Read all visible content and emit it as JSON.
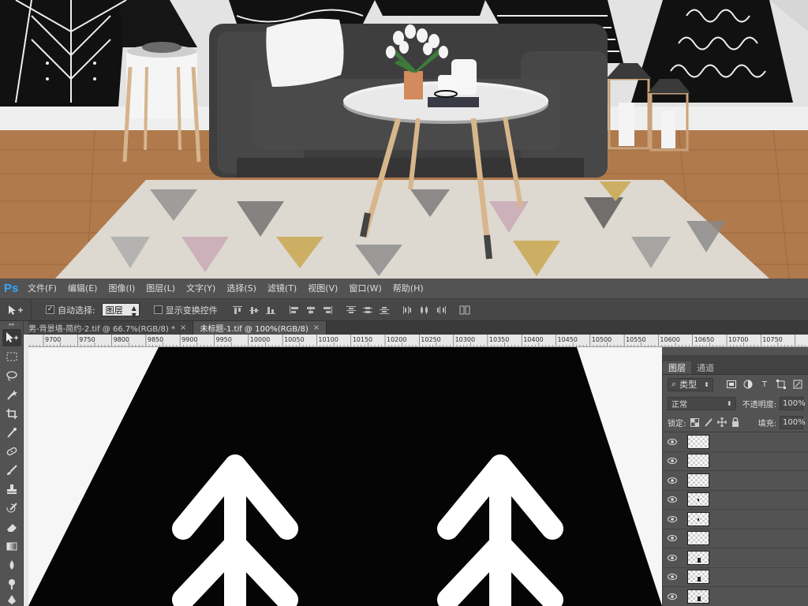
{
  "app": {
    "logo": "Ps"
  },
  "menu": [
    {
      "label": "文件(F)"
    },
    {
      "label": "编辑(E)"
    },
    {
      "label": "图像(I)"
    },
    {
      "label": "图层(L)"
    },
    {
      "label": "文字(Y)"
    },
    {
      "label": "选择(S)"
    },
    {
      "label": "滤镜(T)"
    },
    {
      "label": "视图(V)"
    },
    {
      "label": "窗口(W)"
    },
    {
      "label": "帮助(H)"
    }
  ],
  "options": {
    "auto_select_label": "自动选择:",
    "auto_select_checked": true,
    "auto_select_target": "图层",
    "show_transform_label": "显示变换控件",
    "show_transform_checked": false
  },
  "documents": [
    {
      "title": "男-背景墙-简约-2.tif @ 66.7%(RGB/8) *",
      "active": false
    },
    {
      "title": "未标题-1.tif @ 100%(RGB/8)",
      "active": true
    }
  ],
  "ruler": {
    "labels": [
      "9700",
      "9750",
      "9800",
      "9850",
      "9900",
      "9950",
      "10000",
      "10050",
      "10100",
      "10150",
      "10200",
      "10250",
      "10300",
      "10350",
      "10400",
      "10450",
      "10500",
      "10550",
      "10600",
      "10650",
      "10700",
      "10750"
    ]
  },
  "tools": [
    {
      "icon": "move-icon"
    },
    {
      "icon": "marquee-icon"
    },
    {
      "icon": "lasso-icon"
    },
    {
      "icon": "magic-wand-icon"
    },
    {
      "icon": "crop-icon"
    },
    {
      "icon": "eyedropper-icon"
    },
    {
      "icon": "healing-brush-icon"
    },
    {
      "icon": "brush-icon"
    },
    {
      "icon": "clone-stamp-icon"
    },
    {
      "icon": "history-brush-icon"
    },
    {
      "icon": "eraser-icon"
    },
    {
      "icon": "gradient-icon"
    },
    {
      "icon": "blur-icon"
    },
    {
      "icon": "dodge-icon"
    },
    {
      "icon": "pen-icon"
    }
  ],
  "layers_panel": {
    "tabs": [
      "图层",
      "通道"
    ],
    "filter_label": "类型",
    "blend_mode": "正常",
    "opacity_label": "不透明度:",
    "opacity_value": "100%",
    "lock_label": "锁定:",
    "fill_label": "填充:",
    "fill_value": "100%",
    "layers": [
      {
        "thumb": "empty"
      },
      {
        "thumb": "empty"
      },
      {
        "thumb": "empty"
      },
      {
        "thumb": "dot"
      },
      {
        "thumb": "dot"
      },
      {
        "thumb": "empty"
      },
      {
        "thumb": "figure"
      },
      {
        "thumb": "figure"
      },
      {
        "thumb": "figure"
      }
    ]
  }
}
